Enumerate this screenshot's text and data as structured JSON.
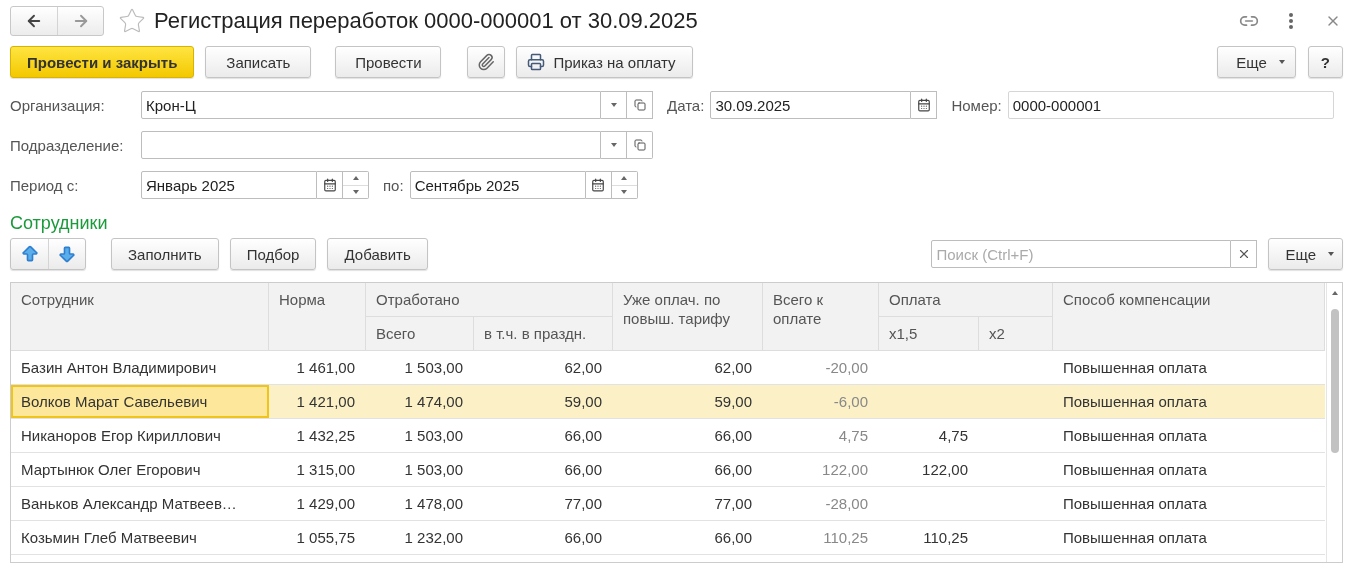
{
  "window": {
    "title": "Регистрация переработок 0000-000001 от 30.09.2025"
  },
  "toolbar": {
    "buttons": [
      {
        "kind": "primary",
        "label": "Провести и закрыть"
      },
      {
        "kind": "plain",
        "label": "Записать"
      },
      {
        "kind": "plain",
        "label": "Провести"
      },
      {
        "kind": "attach"
      },
      {
        "kind": "print",
        "label": "Приказ на оплату"
      }
    ],
    "more": "Еще",
    "help": "?"
  },
  "fields": {
    "organization": {
      "label": "Организация:",
      "value": "Крон-Ц"
    },
    "date": {
      "label": "Дата:",
      "value": "30.09.2025"
    },
    "number": {
      "label": "Номер:",
      "value": "0000-000001"
    },
    "department": {
      "label": "Подразделение:"
    },
    "period_from": {
      "label": "Период с:",
      "value": "Январь 2025"
    },
    "period_to": {
      "label": "по:",
      "value": "Сентябрь 2025"
    }
  },
  "employees": {
    "title": "Сотрудники",
    "buttons": [
      "Заполнить",
      "Подбор",
      "Добавить"
    ],
    "search": {
      "placeholder": "Поиск (Ctrl+F)"
    },
    "more": "Еще",
    "table": {
      "columns": [
        {
          "label": "Сотрудник"
        },
        {
          "label": "Норма"
        },
        {
          "label": "Отработано",
          "children": [
            {
              "label": "Всего"
            },
            {
              "label": "в т.ч. в праздн."
            }
          ]
        },
        {
          "label": "Уже оплач. по повыш. тарифу"
        },
        {
          "label": "Всего к оплате"
        },
        {
          "label": "Оплата",
          "children": [
            {
              "label": "x1,5"
            },
            {
              "label": "x2"
            }
          ]
        },
        {
          "label": "Способ компенсации"
        }
      ],
      "rows": [
        {
          "selected": false,
          "name": "Базин Антон Владимирович",
          "norm": "1 461,00",
          "worked_total": "1 503,00",
          "worked_holiday": "62,00",
          "already_paid": "62,00",
          "to_pay": "-20,00",
          "compensation": "Повышенная оплата"
        },
        {
          "selected": true,
          "name": "Волков Марат Савельевич",
          "norm": "1 421,00",
          "worked_total": "1 474,00",
          "worked_holiday": "59,00",
          "already_paid": "59,00",
          "to_pay": "-6,00",
          "compensation": "Повышенная оплата"
        },
        {
          "selected": false,
          "name": "Никаноров Егор Кириллович",
          "norm": "1 432,25",
          "worked_total": "1 503,00",
          "worked_holiday": "66,00",
          "already_paid": "66,00",
          "to_pay": "4,75",
          "pay_x1_5": "4,75",
          "compensation": "Повышенная оплата"
        },
        {
          "selected": false,
          "name": "Мартынюк Олег Егорович",
          "norm": "1 315,00",
          "worked_total": "1 503,00",
          "worked_holiday": "66,00",
          "already_paid": "66,00",
          "to_pay": "122,00",
          "pay_x1_5": "122,00",
          "compensation": "Повышенная оплата"
        },
        {
          "selected": false,
          "name": "Ваньков Александр Матвеев…",
          "norm": "1 429,00",
          "worked_total": "1 478,00",
          "worked_holiday": "77,00",
          "already_paid": "77,00",
          "to_pay": "-28,00",
          "compensation": "Повышенная оплата"
        },
        {
          "selected": false,
          "name": "Козьмин Глеб Матвеевич",
          "norm": "1 055,75",
          "worked_total": "1 232,00",
          "worked_holiday": "66,00",
          "already_paid": "66,00",
          "to_pay": "110,25",
          "pay_x1_5": "110,25",
          "compensation": "Повышенная оплата"
        }
      ]
    }
  }
}
